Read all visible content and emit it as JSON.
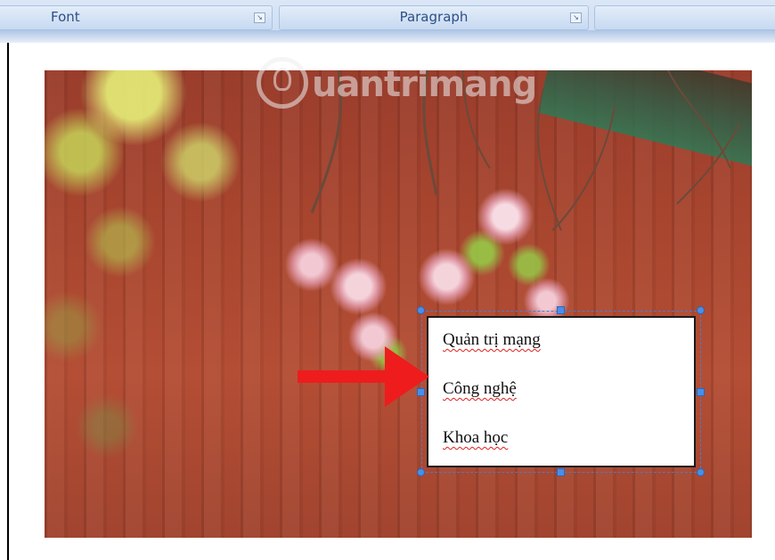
{
  "ribbon": {
    "groups": [
      {
        "label": "Font",
        "launcher_icon": "dialog-launcher-icon"
      },
      {
        "label": "Paragraph",
        "launcher_icon": "dialog-launcher-icon"
      },
      {
        "label": ""
      }
    ]
  },
  "image": {
    "description_icon": "photo-cherry-blossom",
    "watermark_text": "uantrimang"
  },
  "textbox": {
    "lines": [
      "Quản trị mạng",
      "Công nghệ",
      "Khoa học"
    ],
    "spellcheck_underline_color": "#e02020",
    "selection_color": "#4a8ee8"
  },
  "annotation": {
    "arrow_color": "#ee1c1c",
    "arrow_icon": "right-arrow-icon"
  }
}
